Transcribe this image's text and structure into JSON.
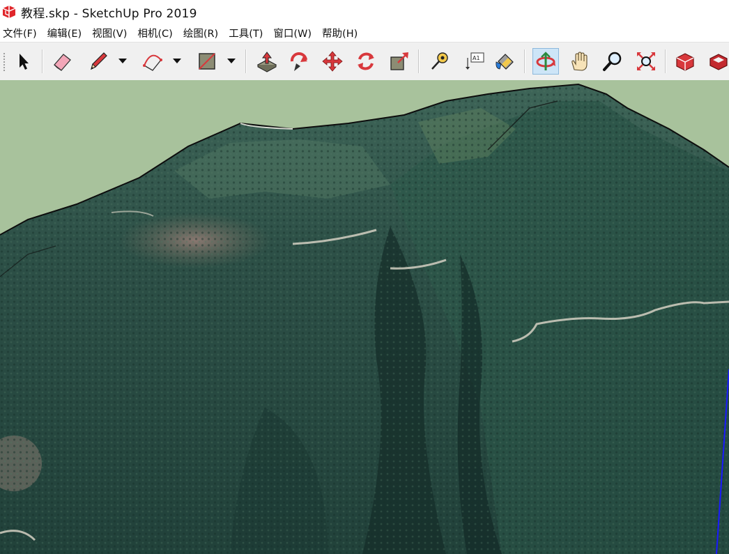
{
  "window": {
    "title": "教程.skp - SketchUp Pro 2019"
  },
  "menu": [
    {
      "id": "file",
      "label": "文件(F)"
    },
    {
      "id": "edit",
      "label": "编辑(E)"
    },
    {
      "id": "view",
      "label": "视图(V)"
    },
    {
      "id": "camera",
      "label": "相机(C)"
    },
    {
      "id": "draw",
      "label": "绘图(R)"
    },
    {
      "id": "tools",
      "label": "工具(T)"
    },
    {
      "id": "window",
      "label": "窗口(W)"
    },
    {
      "id": "help",
      "label": "帮助(H)"
    }
  ],
  "toolbar": {
    "tools": [
      {
        "name": "select-tool",
        "icon": "arrow-cursor-icon"
      },
      {
        "name": "eraser-tool",
        "icon": "eraser-icon"
      },
      {
        "name": "line-tool",
        "icon": "pencil-icon",
        "dropdown": true
      },
      {
        "name": "arc-tool",
        "icon": "arc-icon",
        "dropdown": true
      },
      {
        "name": "rectangle-tool",
        "icon": "rectangle-icon",
        "dropdown": true
      },
      {
        "name": "push-pull-tool",
        "icon": "push-pull-icon"
      },
      {
        "name": "follow-me-tool",
        "icon": "follow-me-icon"
      },
      {
        "name": "move-tool",
        "icon": "move-icon"
      },
      {
        "name": "rotate-tool",
        "icon": "rotate-icon"
      },
      {
        "name": "scale-tool",
        "icon": "scale-icon"
      },
      {
        "name": "tape-measure-tool",
        "icon": "tape-measure-icon"
      },
      {
        "name": "text-tool",
        "icon": "text-label-icon",
        "label": "A1"
      },
      {
        "name": "paint-bucket-tool",
        "icon": "paint-bucket-icon"
      },
      {
        "name": "orbit-tool",
        "icon": "orbit-icon",
        "active": true
      },
      {
        "name": "pan-tool",
        "icon": "hand-icon"
      },
      {
        "name": "zoom-tool",
        "icon": "magnifier-icon"
      },
      {
        "name": "zoom-extents-tool",
        "icon": "zoom-extents-icon"
      },
      {
        "name": "3d-warehouse-tool",
        "icon": "warehouse-icon"
      },
      {
        "name": "extension-warehouse-tool",
        "icon": "extension-warehouse-icon"
      }
    ]
  },
  "viewport": {
    "scene": "terrain-model-satellite-texture",
    "sky_color": "#a8c29c",
    "terrain_color": "#2b4a42",
    "road_color": "#c9c7b8",
    "axis_color": "#1a1aff"
  }
}
